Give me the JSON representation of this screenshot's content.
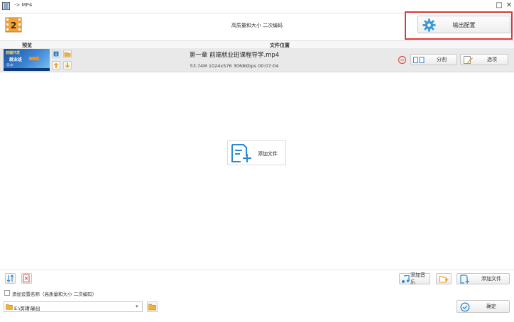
{
  "window": {
    "title": "-> MP4",
    "maximize_glyph": "□",
    "close_glyph": "✕",
    "app_icon": "film-icon"
  },
  "header": {
    "logo_number": "2",
    "title": "高质量和大小 二次编码",
    "output_button_label": "输出配置"
  },
  "columns": {
    "preview": "预览",
    "location": "文件位置"
  },
  "file": {
    "name": "第一章 前端就业班课程导学.mp4",
    "details": "53.74M 1024x576 3068Kbps 00:07:04",
    "thumb_line1": "前端开发",
    "thumb_line2": "就业班",
    "thumb_line3": "导学",
    "split_label": "分割",
    "options_label": "选项"
  },
  "center": {
    "add_file_label": "添加文件"
  },
  "bottom": {
    "add_music_label": "添加音乐",
    "add_file_label": "添加文件",
    "checkbox_label": "添加设置名称（高质量和大小 二次编码）",
    "output_path": "E:\\剪辑\\输出",
    "ok_label": "确定"
  },
  "colors": {
    "accent": "#2a8ad4",
    "highlight_border": "#e03636",
    "orange": "#f0a020"
  }
}
